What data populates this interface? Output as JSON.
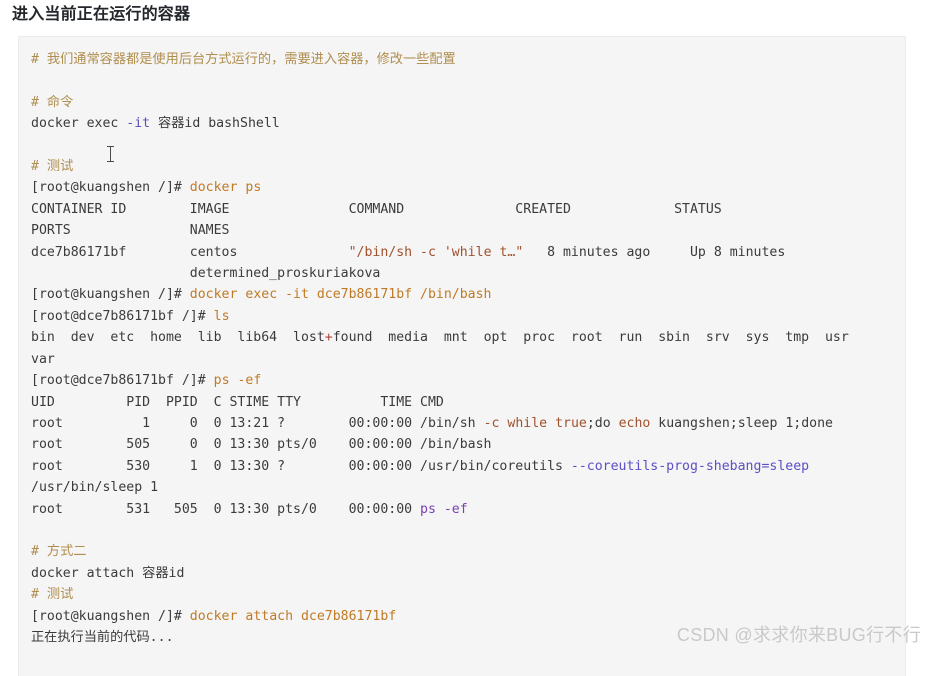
{
  "page": {
    "title": "进入当前正在运行的容器",
    "watermark": "CSDN @求求你来BUG行不行"
  },
  "code_block": {
    "language": "shell",
    "background_color": "#f5f5f5",
    "colors": {
      "comment": "#b08e4f",
      "command": "#c07a26",
      "flag": "#5b4fc4",
      "keyword": "#a0522d",
      "purple": "#7a3fb5",
      "plain": "#3b3b3b"
    },
    "lines": {
      "l1_comment": "# 我们通常容器都是使用后台方式运行的，需要进入容器，修改一些配置",
      "l3_comment": "# 命令",
      "l4_docker": "docker ",
      "l4_exec": "exec ",
      "l4_it": "-it",
      "l4_rest": " 容器id bashShell",
      "l6_comment": "# 测试",
      "l7_prompt": "[root@kuangshen /]# ",
      "l7_cmd": "docker ps",
      "l8_head": "CONTAINER ID        IMAGE               COMMAND              CREATED             STATUS",
      "l9_head": "PORTS               NAMES",
      "l10_a": "dce7b86171bf        centos              ",
      "l10_b": "\"/bin/sh -c 'while t…\"",
      "l10_c": "   8 minutes ago     Up 8 minutes",
      "l11_names": "                    determined_proskuriakova",
      "l12_prompt": "[root@kuangshen /]# ",
      "l12_cmd": "docker exec -it dce7b86171bf /bin/bash",
      "l13_prompt": "[root@dce7b86171bf /]# ",
      "l13_cmd": "ls",
      "l14_a": "bin  dev  etc  home  lib  lib64  lost",
      "l14_plus": "+",
      "l14_b": "found  media  mnt  opt  proc  root  run  sbin  srv  sys  tmp  usr",
      "l15_var": "var",
      "l16_prompt": "[root@dce7b86171bf /]# ",
      "l16_cmd": "ps -ef",
      "l17_head": "UID         PID  PPID  C STIME TTY          TIME CMD",
      "l18_a": "root          1     0  0 13:21 ?        00:00:00 /bin/sh ",
      "l18_k1": "-c",
      "l18_m1": " ",
      "l18_k2": "while",
      "l18_m2": " ",
      "l18_k3": "true",
      "l18_m3": ";do ",
      "l18_k4": "echo",
      "l18_m4": " kuangshen;sleep 1;done",
      "l19": "root        505     0  0 13:30 pts/0    00:00:00 /bin/bash",
      "l20_a": "root        530     1  0 13:30 ?        00:00:00 /usr/bin/coreutils ",
      "l20_flag": "--coreutils-prog-shebang=sleep",
      "l21": "/usr/bin/sleep 1",
      "l22_a": "root        531   505  0 13:30 pts/0    00:00:00 ",
      "l22_cmd": "ps -ef",
      "l24_comment": "# 方式二",
      "l25": "docker attach 容器id",
      "l26_comment": "# 测试",
      "l27_prompt": "[root@kuangshen /]# ",
      "l27_cmd": "docker attach dce7b86171bf",
      "l28": "正在执行当前的代码..."
    }
  }
}
